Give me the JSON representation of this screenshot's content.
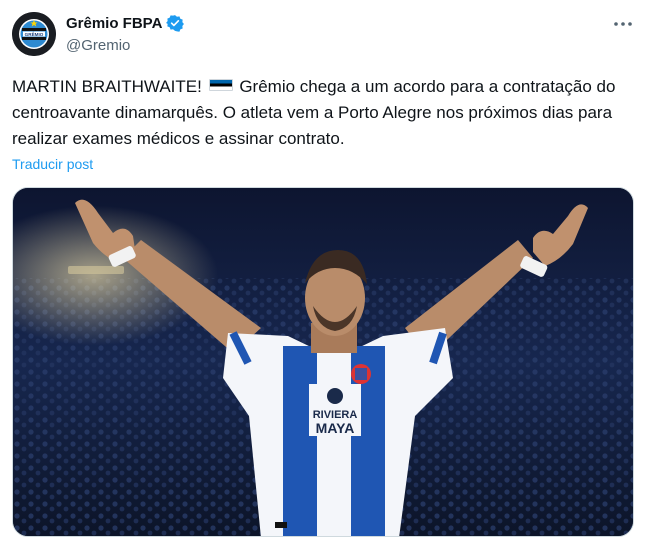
{
  "account": {
    "name": "Grêmio FBPA",
    "handle": "@Gremio",
    "verified": true,
    "avatar_text": "GRÊMIO"
  },
  "tweet": {
    "text_before_flag": "MARTIN BRAITHWAITE!",
    "flag": "estonia-flag",
    "text_after_flag": "Grêmio chega a um acordo para a contratação do centroavante dinamarquês. O atleta vem a Porto Alegre nos próximos dias para realizar exames médicos e assinar contrato.",
    "translate_label": "Traducir post"
  },
  "media": {
    "jersey_sponsor_line1": "RIVIERA",
    "jersey_sponsor_line2": "MAYA"
  },
  "icons": {
    "verified": "verified-badge-icon",
    "more": "more-options-icon"
  },
  "colors": {
    "link": "#1d9bf0",
    "secondary_text": "#536471",
    "primary_text": "#0f1419",
    "verified": "#1d9bf0"
  }
}
